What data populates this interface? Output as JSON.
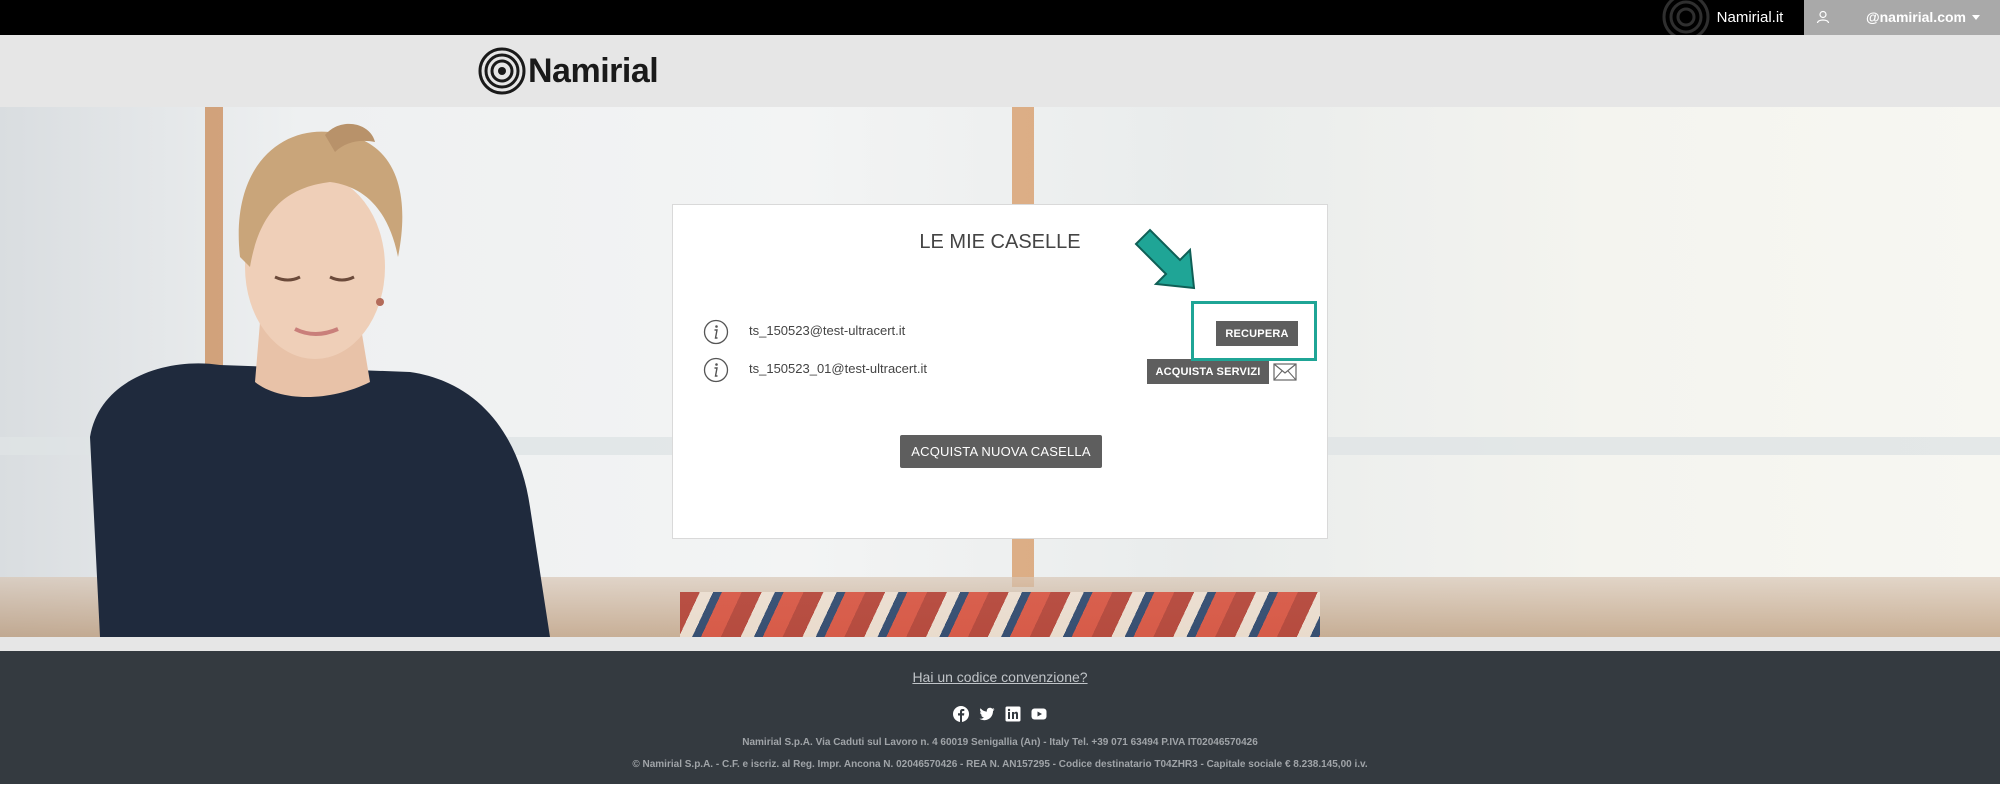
{
  "topbar": {
    "brand_link": "Namirial.it",
    "user_email": "@namirial.com"
  },
  "header": {
    "logo_text": "Namirial"
  },
  "card": {
    "title": "LE MIE CASELLE",
    "mailboxes": [
      {
        "address": "ts_150523@test-ultracert.it",
        "action": "RECUPERA"
      },
      {
        "address": "ts_150523_01@test-ultracert.it",
        "action": "ACQUISTA SERVIZI"
      }
    ],
    "new_mailbox_button": "ACQUISTA NUOVA CASELLA"
  },
  "annotation": {
    "color": "#1fa596"
  },
  "footer": {
    "convenzione_link": "Hai un codice convenzione?",
    "social": [
      "facebook-icon",
      "twitter-icon",
      "linkedin-icon",
      "youtube-icon"
    ],
    "address_line": "Namirial S.p.A. Via Caduti sul Lavoro n. 4 60019 Senigallia (An) - Italy Tel. +39 071 63494 P.IVA IT02046570426",
    "legal_line": "© Namirial S.p.A. - C.F. e iscriz. al Reg. Impr. Ancona N. 02046570426 - REA N. AN157295 - Codice destinatario T04ZHR3 - Capitale sociale € 8.238.145,00 i.v."
  },
  "colors": {
    "topbar": "#000000",
    "header": "#e6e6e6",
    "button": "#5e5e5e",
    "footer": "#343a40"
  }
}
